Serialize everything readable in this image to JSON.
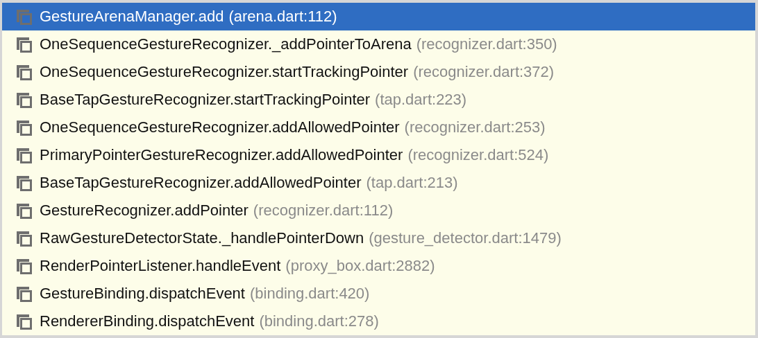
{
  "frames": [
    {
      "method": "GestureArenaManager.add",
      "location": "(arena.dart:112)",
      "selected": true
    },
    {
      "method": "OneSequenceGestureRecognizer._addPointerToArena",
      "location": "(recognizer.dart:350)",
      "selected": false
    },
    {
      "method": "OneSequenceGestureRecognizer.startTrackingPointer",
      "location": "(recognizer.dart:372)",
      "selected": false
    },
    {
      "method": "BaseTapGestureRecognizer.startTrackingPointer",
      "location": "(tap.dart:223)",
      "selected": false
    },
    {
      "method": "OneSequenceGestureRecognizer.addAllowedPointer",
      "location": "(recognizer.dart:253)",
      "selected": false
    },
    {
      "method": "PrimaryPointerGestureRecognizer.addAllowedPointer",
      "location": "(recognizer.dart:524)",
      "selected": false
    },
    {
      "method": "BaseTapGestureRecognizer.addAllowedPointer",
      "location": "(tap.dart:213)",
      "selected": false
    },
    {
      "method": "GestureRecognizer.addPointer",
      "location": "(recognizer.dart:112)",
      "selected": false
    },
    {
      "method": "RawGestureDetectorState._handlePointerDown",
      "location": "(gesture_detector.dart:1479)",
      "selected": false
    },
    {
      "method": "RenderPointerListener.handleEvent",
      "location": "(proxy_box.dart:2882)",
      "selected": false
    },
    {
      "method": "GestureBinding.dispatchEvent",
      "location": "(binding.dart:420)",
      "selected": false
    },
    {
      "method": "RendererBinding.dispatchEvent",
      "location": "(binding.dart:278)",
      "selected": false
    }
  ]
}
